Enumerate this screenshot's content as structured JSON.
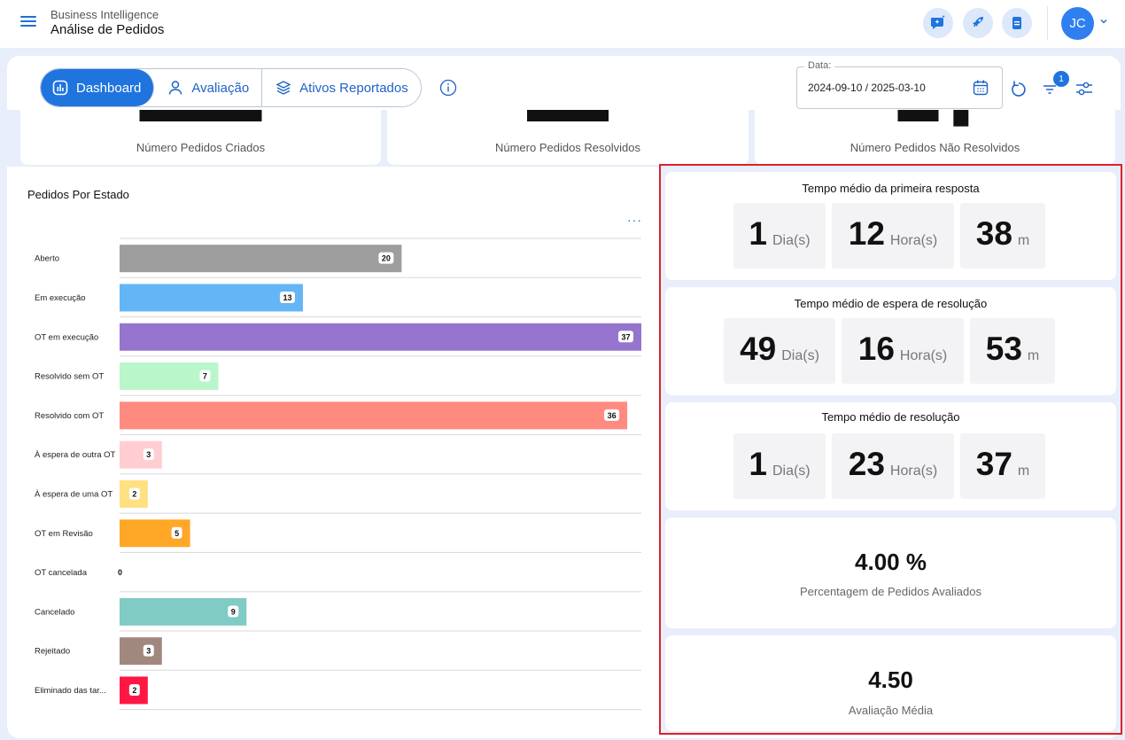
{
  "header": {
    "app_sub": "Business Intelligence",
    "app_title": "Análise de Pedidos",
    "avatar_initials": "JC",
    "icons": [
      "chat-sparkle-icon",
      "rocket-icon",
      "document-icon"
    ]
  },
  "tabs": [
    {
      "label": "Dashboard",
      "icon": "dashboard-icon",
      "active": true
    },
    {
      "label": "Avaliação",
      "icon": "person-icon",
      "active": false
    },
    {
      "label": "Ativos Reportados",
      "icon": "layers-icon",
      "active": false
    }
  ],
  "filter": {
    "label": "Data:",
    "value": "2024-09-10 / 2025-03-10",
    "badge": "1"
  },
  "kpis": [
    {
      "label": "Número Pedidos Criados"
    },
    {
      "label": "Número Pedidos Resolvidos"
    },
    {
      "label": "Número Pedidos Não Resolvidos"
    }
  ],
  "colors": {
    "accent": "#1f74de",
    "highlight_border": "#e0202a"
  },
  "chart_card": {
    "title": "Pedidos Por Estado",
    "more": "···"
  },
  "chart_data": {
    "type": "bar",
    "orientation": "horizontal",
    "title": "Pedidos Por Estado",
    "categories": [
      "Aberto",
      "Em execução",
      "OT em execução",
      "Resolvido sem OT",
      "Resolvido com OT",
      "À espera de outra OT",
      "À espera de uma OT",
      "OT em Revisão",
      "OT cancelada",
      "Cancelado",
      "Rejeitado",
      "Eliminado das tar..."
    ],
    "values": [
      20,
      13,
      37,
      7,
      36,
      3,
      2,
      5,
      0,
      9,
      3,
      2
    ],
    "colors": [
      "#9e9e9e",
      "#64b5f6",
      "#9575cd",
      "#b9f6ca",
      "#ff8a80",
      "#ffcdd2",
      "#ffe082",
      "#ffa726",
      "#cccccc",
      "#80cbc4",
      "#a1887f",
      "#ff1744"
    ],
    "xlim": [
      0,
      37
    ],
    "grid": true,
    "legend": "none"
  },
  "metrics": {
    "first_response": {
      "title": "Tempo médio da primeira resposta",
      "days": "1",
      "hours": "12",
      "minutes": "38"
    },
    "resolution_wait": {
      "title": "Tempo médio de espera de resolução",
      "days": "49",
      "hours": "16",
      "minutes": "53"
    },
    "resolution": {
      "title": "Tempo médio de resolução",
      "days": "1",
      "hours": "23",
      "minutes": "37"
    },
    "units": {
      "days": "Dia(s)",
      "hours": "Hora(s)",
      "minutes": "m"
    },
    "rated_pct": {
      "value": "4.00 %",
      "label": "Percentagem de Pedidos Avaliados"
    },
    "avg_rating": {
      "value": "4.50",
      "label": "Avaliação Média"
    }
  }
}
